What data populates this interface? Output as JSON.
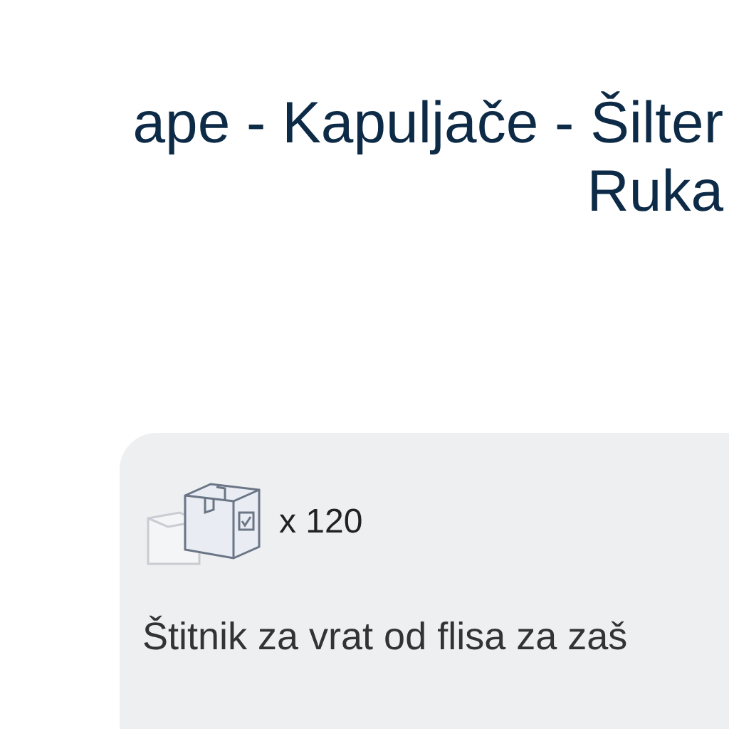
{
  "title_lines": [
    "ape - Kapuljače - Šilter",
    "Ruka"
  ],
  "card": {
    "quantity": "x 120",
    "description": "Štitnik za vrat od flisa za zaš"
  }
}
